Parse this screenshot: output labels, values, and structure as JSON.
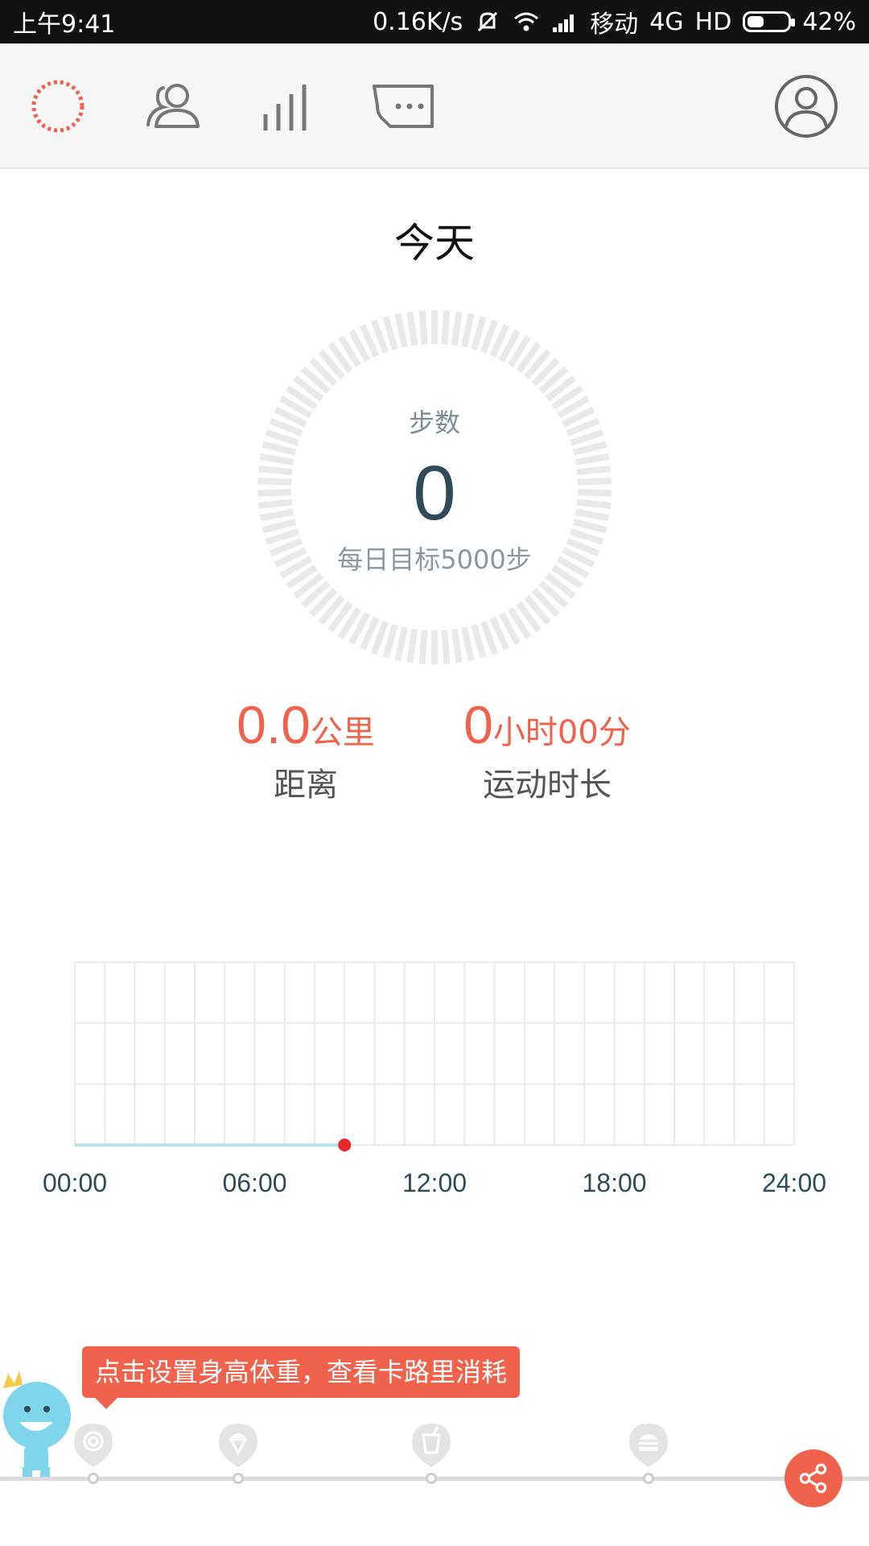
{
  "status_bar": {
    "time": "上午9:41",
    "net_speed": "0.16K/s",
    "carrier": "移动",
    "network": "4G",
    "hd": "HD",
    "battery": "42%",
    "battery_level": 0.42
  },
  "nav": {
    "icons": [
      "activity-ring-icon",
      "friends-icon",
      "stats-icon",
      "messages-icon"
    ],
    "profile_icon": "profile-icon",
    "active_color": "#f0624b"
  },
  "today": {
    "title": "今天",
    "steps_label": "步数",
    "steps_value": "0",
    "goal_text": "每日目标5000步",
    "progress": 0
  },
  "stats": {
    "distance_value": "0.0",
    "distance_unit": "公里",
    "distance_label": "距离",
    "duration_hours": "0",
    "duration_unit_h": "小时",
    "duration_minutes": "00",
    "duration_unit_m": "分",
    "duration_label": "运动时长"
  },
  "chart_data": {
    "type": "line",
    "x_ticks": [
      "00:00",
      "06:00",
      "12:00",
      "18:00",
      "24:00"
    ],
    "x_range": [
      0,
      24
    ],
    "series": [
      {
        "x": [
          0,
          9
        ],
        "y": [
          0,
          0
        ]
      }
    ],
    "current_point": {
      "x": 9,
      "y": 0
    },
    "grid": true,
    "colors": {
      "line": "#b9e3ea",
      "point": "#e8262b",
      "grid": "#e9ecee"
    }
  },
  "bottom": {
    "tooltip": "点击设置身高体重，查看卡路里消耗",
    "milestones": [
      "lollipop-icon",
      "ice-cream-icon",
      "drink-icon",
      "burger-icon"
    ],
    "share_icon": "share-icon",
    "accent": "#f0624b"
  }
}
